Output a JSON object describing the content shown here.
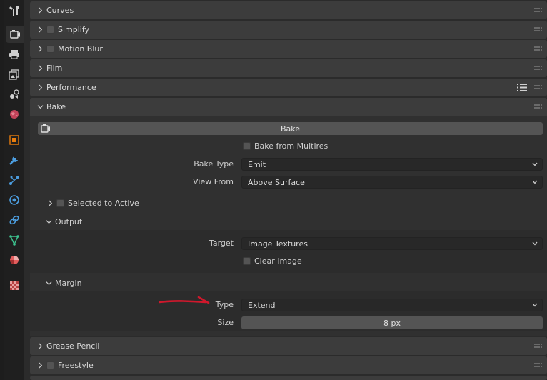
{
  "panels": {
    "curves": "Curves",
    "simplify": "Simplify",
    "motion_blur": "Motion Blur",
    "film": "Film",
    "performance": "Performance",
    "bake": "Bake",
    "grease_pencil": "Grease Pencil",
    "freestyle": "Freestyle"
  },
  "bake": {
    "button_label": "Bake",
    "bake_from_multires": "Bake from Multires",
    "bake_type_label": "Bake Type",
    "bake_type_value": "Emit",
    "view_from_label": "View From",
    "view_from_value": "Above Surface",
    "selected_to_active": "Selected to Active",
    "output": {
      "title": "Output",
      "target_label": "Target",
      "target_value": "Image Textures",
      "clear_image": "Clear Image"
    },
    "margin": {
      "title": "Margin",
      "type_label": "Type",
      "type_value": "Extend",
      "size_label": "Size",
      "size_value": "8 px"
    }
  },
  "colors": {
    "annotation_arrow": "#d0182c",
    "active_tab": "#303030",
    "panel_header": "#3c3c3c"
  },
  "icons": {
    "tabs": [
      "tool-icon",
      "render-icon",
      "output-icon",
      "view-layer-icon",
      "scene-icon",
      "world-icon",
      "object-icon",
      "modifiers-icon",
      "particles-icon",
      "physics-icon",
      "constraints-icon",
      "data-icon",
      "material-icon",
      "texture-icon"
    ]
  }
}
